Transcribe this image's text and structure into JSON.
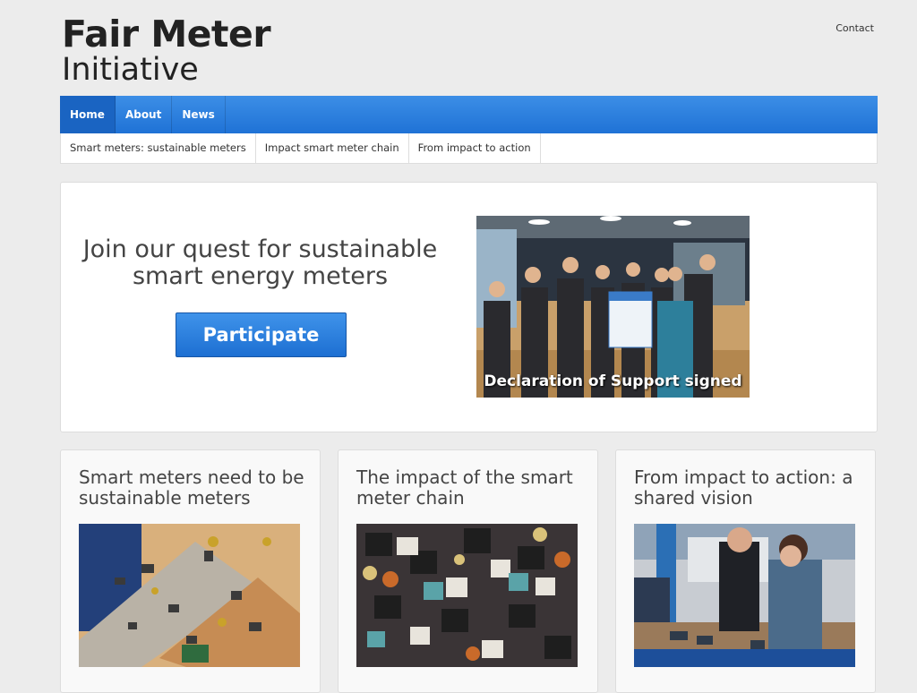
{
  "header": {
    "logo_line1": "Fair Meter",
    "logo_line2": "Initiative",
    "contact": "Contact"
  },
  "nav": {
    "items": [
      {
        "label": "Home"
      },
      {
        "label": "About"
      },
      {
        "label": "News"
      }
    ]
  },
  "subnav": {
    "items": [
      {
        "label": "Smart meters: sustainable meters"
      },
      {
        "label": "Impact smart meter chain"
      },
      {
        "label": "From impact to action"
      }
    ]
  },
  "hero": {
    "heading": "Join our quest for sustainable smart energy meters",
    "button": "Participate",
    "image_caption": "Declaration of Support signed"
  },
  "cards": [
    {
      "title": "Smart meters need to be sustainable meters"
    },
    {
      "title": "The impact of the smart meter chain"
    },
    {
      "title": "From impact to action: a shared vision"
    }
  ],
  "colors": {
    "nav_blue": "#2a7fde",
    "button_blue": "#1f72d6",
    "page_bg": "#ececec"
  }
}
